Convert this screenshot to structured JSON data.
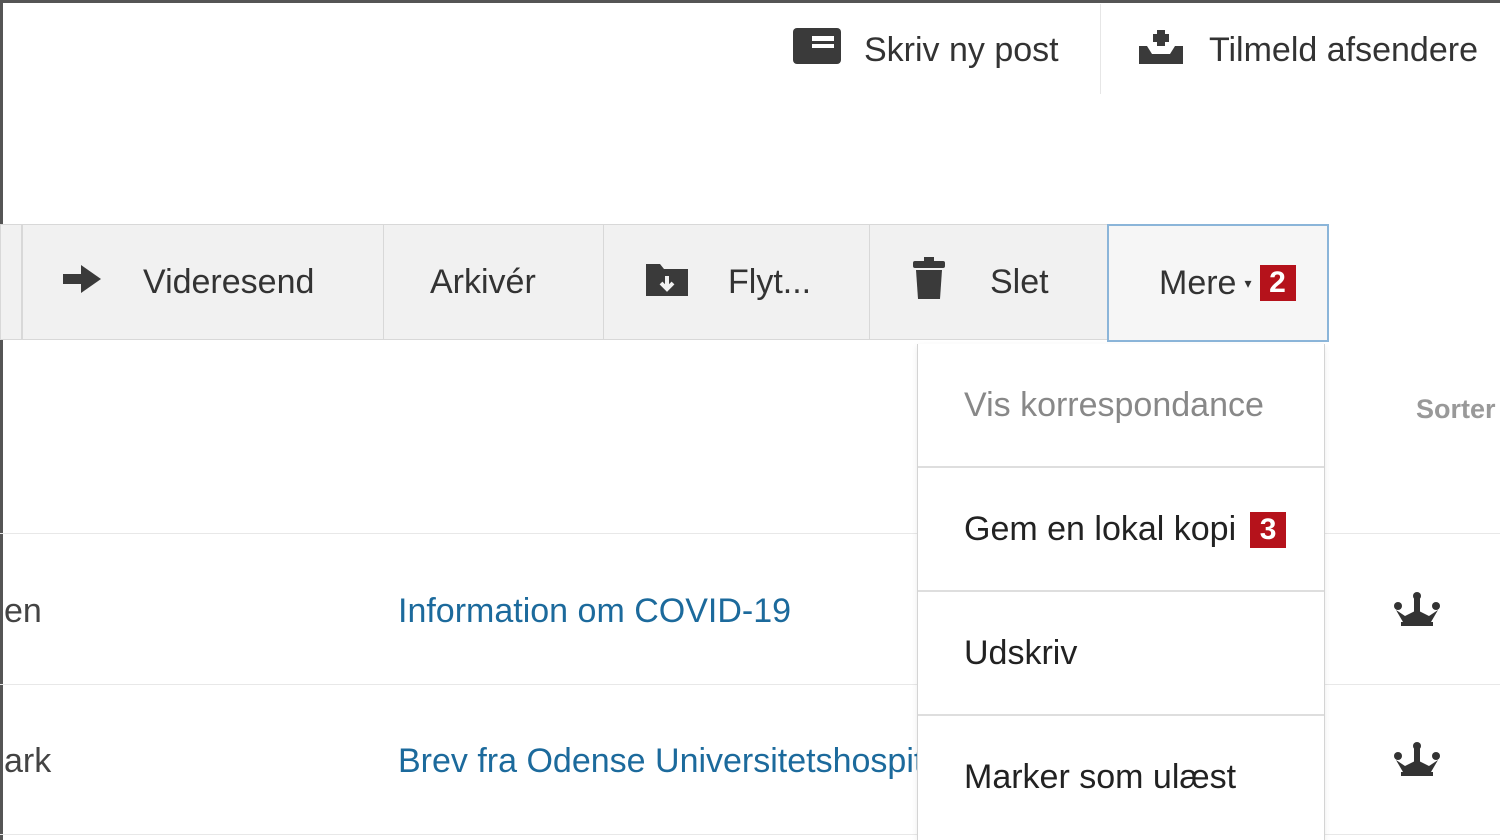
{
  "header": {
    "compose_label": "Skriv ny post",
    "compose_icon": "compose-envelope-icon",
    "subscribe_label": "Tilmeld afsendere",
    "subscribe_icon": "inbox-upload-icon"
  },
  "toolbar": {
    "forward_label": "Videresend",
    "forward_icon": "arrow-right-icon",
    "archive_label": "Arkivér",
    "move_label": "Flyt...",
    "move_icon": "folder-move-icon",
    "delete_label": "Slet",
    "delete_icon": "trash-icon",
    "more_label": "Mere",
    "more_badge": "2"
  },
  "list": {
    "sort_label": "Sorter",
    "rows": [
      {
        "sender": "en",
        "subject": "Information om COVID-19",
        "icon": "crown-icon"
      },
      {
        "sender": "ark",
        "subject": "Brev fra Odense Universitetshospital",
        "icon": "crown-icon"
      }
    ]
  },
  "dropdown": {
    "items": [
      {
        "label": "Vis korrespondance",
        "disabled": true
      },
      {
        "label": "Gem en lokal kopi",
        "badge": "3"
      },
      {
        "label": "Udskriv"
      },
      {
        "label": "Marker som ulæst"
      }
    ]
  },
  "colors": {
    "badge": "#b5121b",
    "link": "#1c6a9c",
    "focus_border": "#8bb5d9",
    "toolbar_bg": "#f1f1f1"
  }
}
